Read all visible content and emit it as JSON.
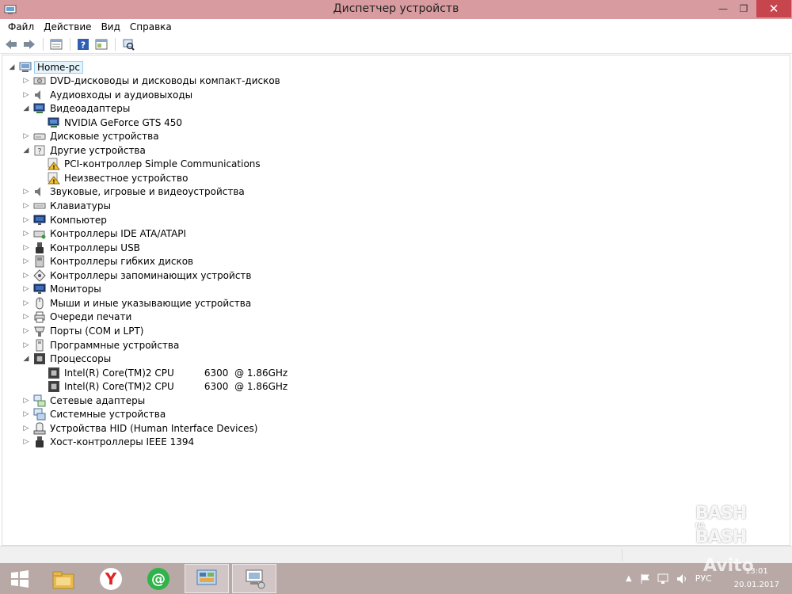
{
  "window": {
    "title": "Диспетчер устройств",
    "minimize_glyph": "—",
    "maximize_glyph": "❐",
    "close_glyph": "✕"
  },
  "menu": {
    "items": [
      "Файл",
      "Действие",
      "Вид",
      "Справка"
    ]
  },
  "toolbar": {
    "buttons": [
      "back-icon",
      "forward-icon",
      "properties-icon",
      "help-icon",
      "show-hide-icon",
      "scan-hardware-icon"
    ]
  },
  "tree": {
    "root": {
      "label": "Home-pc",
      "icon": "computer-icon",
      "expanded": true,
      "selected": true
    },
    "nodes": [
      {
        "label": "DVD-дисководы и дисководы компакт-дисков",
        "icon": "dvd-drive-icon",
        "level": 1,
        "expanded": false
      },
      {
        "label": "Аудиовходы и аудиовыходы",
        "icon": "speaker-icon",
        "level": 1,
        "expanded": false
      },
      {
        "label": "Видеоадаптеры",
        "icon": "display-adapter-icon",
        "level": 1,
        "expanded": true
      },
      {
        "label": "NVIDIA GeForce GTS 450",
        "icon": "display-adapter-icon",
        "level": 2
      },
      {
        "label": "Дисковые устройства",
        "icon": "disk-drive-icon",
        "level": 1,
        "expanded": false
      },
      {
        "label": "Другие устройства",
        "icon": "unknown-device-icon",
        "level": 1,
        "expanded": true
      },
      {
        "label": "PCI-контроллер Simple Communications",
        "icon": "warning-device-icon",
        "level": 2
      },
      {
        "label": "Неизвестное устройство",
        "icon": "warning-device-icon",
        "level": 2
      },
      {
        "label": "Звуковые, игровые и видеоустройства",
        "icon": "speaker-icon",
        "level": 1,
        "expanded": false
      },
      {
        "label": "Клавиатуры",
        "icon": "keyboard-icon",
        "level": 1,
        "expanded": false
      },
      {
        "label": "Компьютер",
        "icon": "monitor-icon",
        "level": 1,
        "expanded": false
      },
      {
        "label": "Контроллеры IDE ATA/ATAPI",
        "icon": "ide-controller-icon",
        "level": 1,
        "expanded": false
      },
      {
        "label": "Контроллеры USB",
        "icon": "usb-icon",
        "level": 1,
        "expanded": false
      },
      {
        "label": "Контроллеры гибких дисков",
        "icon": "floppy-controller-icon",
        "level": 1,
        "expanded": false
      },
      {
        "label": "Контроллеры запоминающих устройств",
        "icon": "storage-controller-icon",
        "level": 1,
        "expanded": false
      },
      {
        "label": "Мониторы",
        "icon": "monitor-icon",
        "level": 1,
        "expanded": false
      },
      {
        "label": "Мыши и иные указывающие устройства",
        "icon": "mouse-icon",
        "level": 1,
        "expanded": false
      },
      {
        "label": "Очереди печати",
        "icon": "printer-icon",
        "level": 1,
        "expanded": false
      },
      {
        "label": "Порты (COM и LPT)",
        "icon": "port-icon",
        "level": 1,
        "expanded": false
      },
      {
        "label": "Программные устройства",
        "icon": "software-device-icon",
        "level": 1,
        "expanded": false
      },
      {
        "label": "Процессоры",
        "icon": "processor-icon",
        "level": 1,
        "expanded": true
      },
      {
        "label": "Intel(R) Core(TM)2 CPU          6300  @ 1.86GHz",
        "icon": "processor-icon",
        "level": 2
      },
      {
        "label": "Intel(R) Core(TM)2 CPU          6300  @ 1.86GHz",
        "icon": "processor-icon",
        "level": 2
      },
      {
        "label": "Сетевые адаптеры",
        "icon": "network-adapter-icon",
        "level": 1,
        "expanded": false
      },
      {
        "label": "Системные устройства",
        "icon": "system-device-icon",
        "level": 1,
        "expanded": false
      },
      {
        "label": "Устройства HID (Human Interface Devices)",
        "icon": "hid-icon",
        "level": 1,
        "expanded": false
      },
      {
        "label": "Хост-контроллеры IEEE 1394",
        "icon": "ieee1394-icon",
        "level": 1,
        "expanded": false
      }
    ]
  },
  "taskbar": {
    "items": [
      "start-icon",
      "file-explorer-icon",
      "yandex-browser-icon",
      "icq-icon",
      "control-panel-icon",
      "device-manager-icon"
    ],
    "language": "РУС",
    "time": "13:01",
    "date": "20.01.2017"
  },
  "watermarks": {
    "bash_top": "BASH",
    "bash_mid": "NA",
    "bash_bottom": "BASH",
    "avito": "Avito"
  },
  "colors": {
    "titlebar": "#d89ba0",
    "close_button": "#c7464e",
    "taskbar": "#b8a8a6",
    "selection_bg": "#e5f3fb",
    "selection_border": "#9bcdf0"
  }
}
